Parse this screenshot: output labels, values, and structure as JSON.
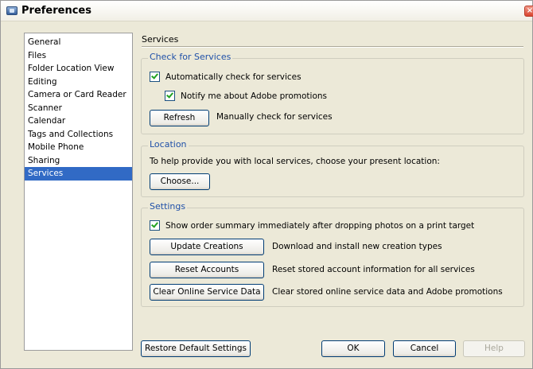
{
  "window": {
    "title": "Preferences",
    "close_glyph": "×"
  },
  "nav": {
    "items": [
      {
        "label": "General"
      },
      {
        "label": "Files"
      },
      {
        "label": "Folder Location View"
      },
      {
        "label": "Editing"
      },
      {
        "label": "Camera or Card Reader"
      },
      {
        "label": "Scanner"
      },
      {
        "label": "Calendar"
      },
      {
        "label": "Tags and Collections"
      },
      {
        "label": "Mobile Phone"
      },
      {
        "label": "Sharing"
      },
      {
        "label": "Services"
      }
    ],
    "selected": "Services"
  },
  "panel": {
    "title": "Services"
  },
  "check_for_services": {
    "title": "Check for Services",
    "auto_check": {
      "label": "Automatically check for services",
      "checked": true
    },
    "notify_promotions": {
      "label": "Notify me about Adobe promotions",
      "checked": true
    },
    "refresh_button": "Refresh",
    "refresh_description": "Manually check for services"
  },
  "location": {
    "title": "Location",
    "description": "To help provide you with local services, choose your present location:",
    "choose_button": "Choose..."
  },
  "settings": {
    "title": "Settings",
    "order_summary": {
      "label": "Show order summary immediately after dropping photos on a print target",
      "checked": true
    },
    "update_creations_button": "Update Creations",
    "update_creations_description": "Download and install new creation types",
    "reset_accounts_button": "Reset Accounts",
    "reset_accounts_description": "Reset stored account information for all services",
    "clear_data_button": "Clear Online Service Data",
    "clear_data_description": "Clear stored online service data and Adobe promotions"
  },
  "footer": {
    "restore_button": "Restore Default Settings",
    "ok_button": "OK",
    "cancel_button": "Cancel",
    "help_button": "Help"
  },
  "colors": {
    "group_title": "#1f50a8",
    "selection": "#316ac5",
    "dialog_bg": "#ece9d8"
  }
}
